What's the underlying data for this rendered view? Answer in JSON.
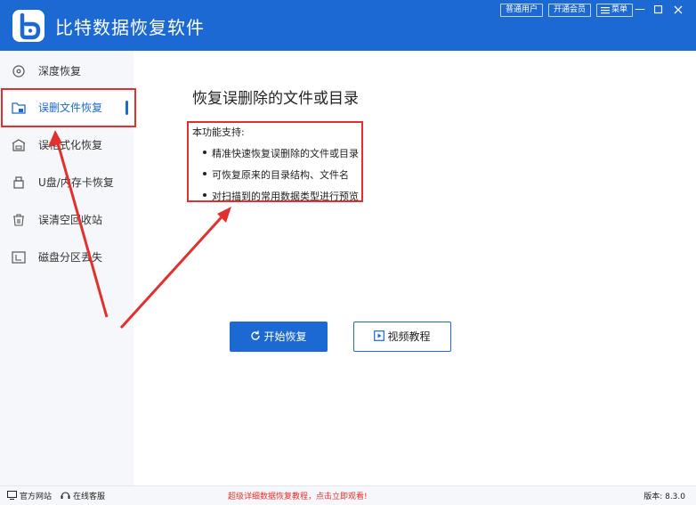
{
  "app": {
    "title": "比特数据恢复软件"
  },
  "titlebar": {
    "buttons": [
      "普通用户",
      "开通会员",
      "菜单"
    ],
    "controls": [
      "minimize-icon",
      "maximize-icon",
      "close-icon"
    ]
  },
  "sidebar": {
    "items": [
      {
        "label": "深度恢复",
        "icon": "disc-icon"
      },
      {
        "label": "误删文件恢复",
        "icon": "folder-icon",
        "active": true
      },
      {
        "label": "误格式化恢复",
        "icon": "drive-icon"
      },
      {
        "label": "U盘/内存卡恢复",
        "icon": "usb-icon"
      },
      {
        "label": "误清空回收站",
        "icon": "trash-icon"
      },
      {
        "label": "磁盘分区丢失",
        "icon": "partition-icon"
      }
    ]
  },
  "main": {
    "title": "恢复误删除的文件或目录",
    "support_heading": "本功能支持:",
    "features": [
      "精准快速恢复误删除的文件或目录",
      "可恢复原来的目录结构、文件名",
      "对扫描到的常用数据类型进行预览"
    ],
    "start_button": "开始恢复",
    "video_button": "视频教程"
  },
  "footer": {
    "website": "官方网站",
    "support": "在线客服",
    "promo": "超级详细数据恢复教程，点击立即观看!",
    "version": "版本: 8.3.0"
  },
  "colors": {
    "brand": "#1c69d4",
    "annotation": "#e0312e"
  }
}
